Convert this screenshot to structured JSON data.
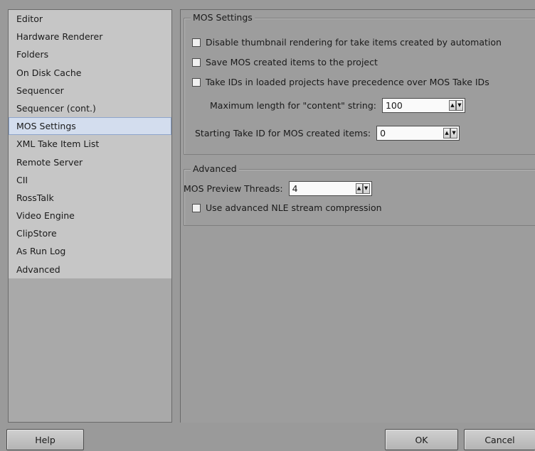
{
  "sidebar": {
    "items": [
      {
        "label": "Editor"
      },
      {
        "label": "Hardware Renderer"
      },
      {
        "label": "Folders"
      },
      {
        "label": "On Disk Cache"
      },
      {
        "label": "Sequencer"
      },
      {
        "label": "Sequencer (cont.)"
      },
      {
        "label": "MOS Settings"
      },
      {
        "label": "XML Take Item List"
      },
      {
        "label": "Remote Server"
      },
      {
        "label": "CII"
      },
      {
        "label": "RossTalk"
      },
      {
        "label": "Video Engine"
      },
      {
        "label": "ClipStore"
      },
      {
        "label": "As Run Log"
      },
      {
        "label": "Advanced"
      }
    ],
    "selected": "MOS Settings"
  },
  "mos_settings": {
    "title": "MOS Settings",
    "checkbox_disable_thumbnail": "Disable thumbnail rendering for take items created by automation",
    "checkbox_save_mos_items": "Save MOS created items to the project",
    "checkbox_take_ids_precedence": "Take IDs in loaded projects have precedence over MOS Take IDs",
    "max_length_label": "Maximum length for \"content\" string:",
    "max_length_value": "100",
    "starting_take_id_label": "Starting Take ID for MOS created items:",
    "starting_take_id_value": "0"
  },
  "advanced": {
    "title": "Advanced",
    "preview_threads_label": "MOS Preview Threads:",
    "preview_threads_value": "4",
    "checkbox_nle_compression": "Use advanced NLE stream compression"
  },
  "buttons": {
    "help": "Help",
    "ok": "OK",
    "cancel": "Cancel"
  }
}
